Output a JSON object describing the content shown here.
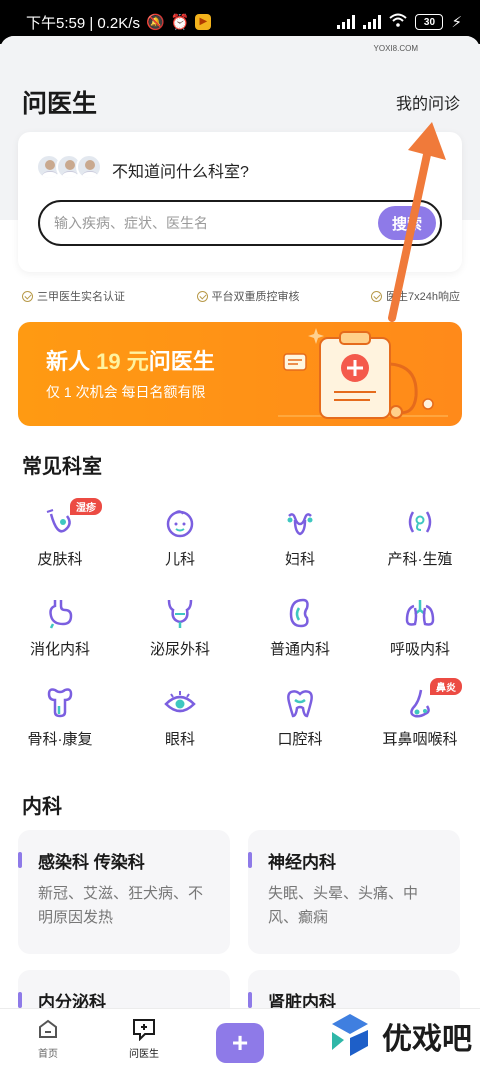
{
  "status_bar": {
    "time_speed": "下午5:59 | 0.2K/s",
    "battery": "30"
  },
  "header": {
    "title": "问医生",
    "my_consult": "我的问诊"
  },
  "search": {
    "hint": "不知道问什么科室?",
    "placeholder": "输入疾病、症状、医生名",
    "button_label": "搜索"
  },
  "trust": [
    {
      "label": "三甲医生实名认证"
    },
    {
      "label": "平台双重质控审核"
    },
    {
      "label": "医生7x24h响应"
    }
  ],
  "banner": {
    "title_prefix": "新人 ",
    "title_amount": "19 元",
    "title_suffix": "问医生",
    "subtitle": "仅 1 次机会  每日名额有限"
  },
  "common_departments": {
    "title": "常见科室",
    "items": [
      {
        "label": "皮肤科",
        "icon": "skin-icon",
        "tag": "湿疹"
      },
      {
        "label": "儿科",
        "icon": "child-face-icon"
      },
      {
        "label": "妇科",
        "icon": "uterus-icon"
      },
      {
        "label": "产科·生殖",
        "icon": "fetus-icon"
      },
      {
        "label": "消化内科",
        "icon": "stomach-icon"
      },
      {
        "label": "泌尿外科",
        "icon": "bladder-icon"
      },
      {
        "label": "普通内科",
        "icon": "kidney-icon"
      },
      {
        "label": "呼吸内科",
        "icon": "lungs-icon"
      },
      {
        "label": "骨科·康复",
        "icon": "bone-icon"
      },
      {
        "label": "眼科",
        "icon": "eye-icon"
      },
      {
        "label": "口腔科",
        "icon": "tooth-icon"
      },
      {
        "label": "耳鼻咽喉科",
        "icon": "nose-icon",
        "tag": "鼻炎"
      }
    ]
  },
  "internal_medicine": {
    "title": "内科",
    "cards": [
      {
        "title": "感染科 传染科",
        "desc": "新冠、艾滋、狂犬病、不明原因发热"
      },
      {
        "title": "神经内科",
        "desc": "失眠、头晕、头痛、中风、癫痫"
      },
      {
        "title": "内分泌科",
        "desc": ""
      },
      {
        "title": "肾脏内科",
        "desc": ""
      }
    ]
  },
  "tabbar": {
    "home": "首页",
    "ask_doctor": "问医生"
  },
  "watermark": {
    "text": "优戏吧",
    "domain": "YOXI8.COM"
  },
  "colors": {
    "accent": "#8e7ae8",
    "banner": "#ff9a12",
    "annotation_arrow": "#f07a3a",
    "tag": "#ec4b43"
  }
}
